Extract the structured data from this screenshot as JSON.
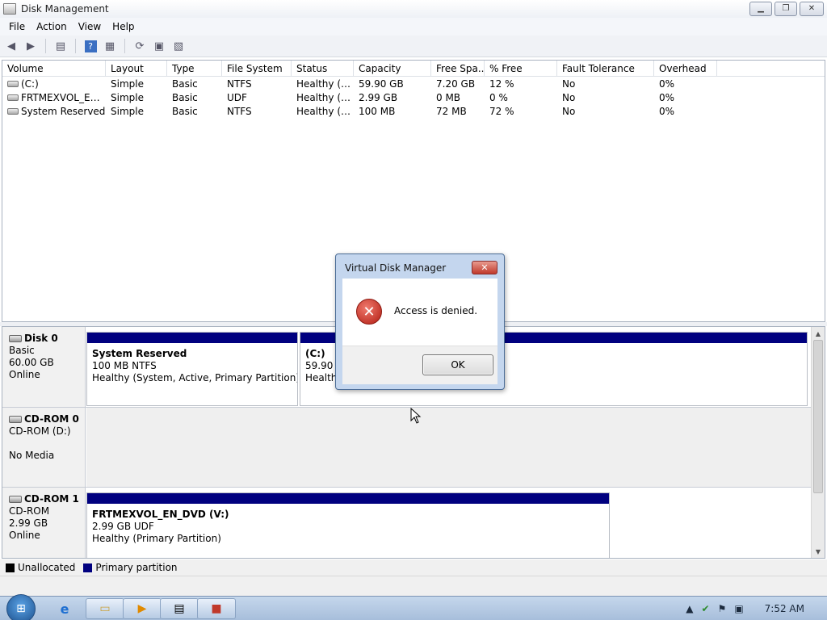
{
  "window": {
    "title": "Disk Management",
    "minimize": "▭",
    "maximize": "❐",
    "close": "✕"
  },
  "menu": [
    "File",
    "Action",
    "View",
    "Help"
  ],
  "toolbar_icons": [
    "back-icon",
    "forward-icon",
    "show-hide-tree-icon",
    "help-icon",
    "properties-icon",
    "refresh-icon",
    "rescan-icon",
    "export-icon"
  ],
  "volumes": {
    "columns": [
      "Volume",
      "Layout",
      "Type",
      "File System",
      "Status",
      "Capacity",
      "Free Spa...",
      "% Free",
      "Fault Tolerance",
      "Overhead"
    ],
    "rows": [
      {
        "volume": "(C:)",
        "layout": "Simple",
        "type": "Basic",
        "fs": "NTFS",
        "status": "Healthy (B...",
        "capacity": "59.90 GB",
        "free": "7.20 GB",
        "pct": "12 %",
        "fault": "No",
        "overhead": "0%"
      },
      {
        "volume": "FRTMEXVOL_EN_...",
        "layout": "Simple",
        "type": "Basic",
        "fs": "UDF",
        "status": "Healthy (P...",
        "capacity": "2.99 GB",
        "free": "0 MB",
        "pct": "0 %",
        "fault": "No",
        "overhead": "0%"
      },
      {
        "volume": "System Reserved",
        "layout": "Simple",
        "type": "Basic",
        "fs": "NTFS",
        "status": "Healthy (S...",
        "capacity": "100 MB",
        "free": "72 MB",
        "pct": "72 %",
        "fault": "No",
        "overhead": "0%"
      }
    ]
  },
  "disks": {
    "disk0": {
      "name": "Disk 0",
      "type": "Basic",
      "size": "60.00 GB",
      "state": "Online",
      "partitions": [
        {
          "name": "System Reserved",
          "size": "100 MB NTFS",
          "status": "Healthy (System, Active, Primary Partition)"
        },
        {
          "name": "(C:)",
          "size": "59.90 G",
          "status": "Healthy"
        }
      ]
    },
    "cdrom0": {
      "name": "CD-ROM 0",
      "type": "CD-ROM (D:)",
      "state": "No Media"
    },
    "cdrom1": {
      "name": "CD-ROM 1",
      "type": "CD-ROM",
      "size": "2.99 GB",
      "state": "Online",
      "partitions": [
        {
          "name": "FRTMEXVOL_EN_DVD  (V:)",
          "size": "2.99 GB UDF",
          "status": "Healthy (Primary Partition)"
        }
      ]
    }
  },
  "legend": [
    {
      "label": "Unallocated",
      "color": "#000000"
    },
    {
      "label": "Primary partition",
      "color": "#00007f"
    }
  ],
  "dialog": {
    "title": "Virtual Disk Manager",
    "message": "Access is denied.",
    "ok": "OK",
    "close": "✕"
  },
  "taskbar": {
    "clock": "7:52 AM",
    "tray_icons": [
      "show-hidden-icons-icon",
      "action-center-icon",
      "flag-icon",
      "network-icon"
    ],
    "apps": [
      "ie-icon",
      "explorer-icon",
      "media-player-icon",
      "disk-management-icon",
      "toolbox-icon"
    ]
  }
}
